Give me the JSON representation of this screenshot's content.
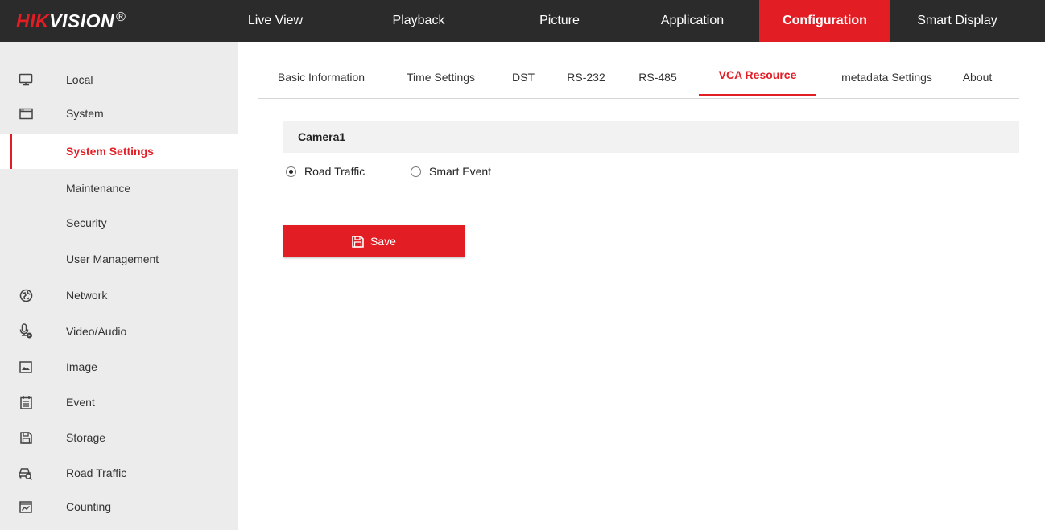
{
  "header": {
    "logo_red": "HIK",
    "logo_white": "VISION",
    "logo_mark": "®",
    "nav": [
      {
        "label": "Live View",
        "active": false
      },
      {
        "label": "Playback",
        "active": false
      },
      {
        "label": "Picture",
        "active": false
      },
      {
        "label": "Application",
        "active": false
      },
      {
        "label": "Configuration",
        "active": true
      },
      {
        "label": "Smart Display",
        "active": false
      }
    ]
  },
  "sidebar": {
    "items": [
      {
        "label": "Local",
        "icon": "monitor-icon"
      },
      {
        "label": "System",
        "icon": "window-icon"
      },
      {
        "label": "System Settings",
        "selected": true
      },
      {
        "label": "Maintenance"
      },
      {
        "label": "Security"
      },
      {
        "label": "User Management"
      },
      {
        "label": "Network",
        "icon": "globe-icon"
      },
      {
        "label": "Video/Audio",
        "icon": "microphone-icon"
      },
      {
        "label": "Image",
        "icon": "image-icon"
      },
      {
        "label": "Event",
        "icon": "calendar-icon"
      },
      {
        "label": "Storage",
        "icon": "floppy-icon"
      },
      {
        "label": "Road Traffic",
        "icon": "car-search-icon"
      },
      {
        "label": "Counting",
        "icon": "chart-icon"
      }
    ]
  },
  "tabs": [
    {
      "label": "Basic Information",
      "active": false
    },
    {
      "label": "Time Settings",
      "active": false
    },
    {
      "label": "DST",
      "active": false
    },
    {
      "label": "RS-232",
      "active": false
    },
    {
      "label": "RS-485",
      "active": false
    },
    {
      "label": "VCA Resource",
      "active": true
    },
    {
      "label": "metadata Settings",
      "active": false
    },
    {
      "label": "About",
      "active": false
    }
  ],
  "content": {
    "camera_label": "Camera1",
    "options": [
      {
        "label": "Road Traffic",
        "checked": true
      },
      {
        "label": "Smart Event",
        "checked": false
      }
    ],
    "save_label": "Save"
  },
  "colors": {
    "accent": "#e21d24",
    "topbar": "#2b2b2b",
    "sidebar": "#ececec"
  }
}
